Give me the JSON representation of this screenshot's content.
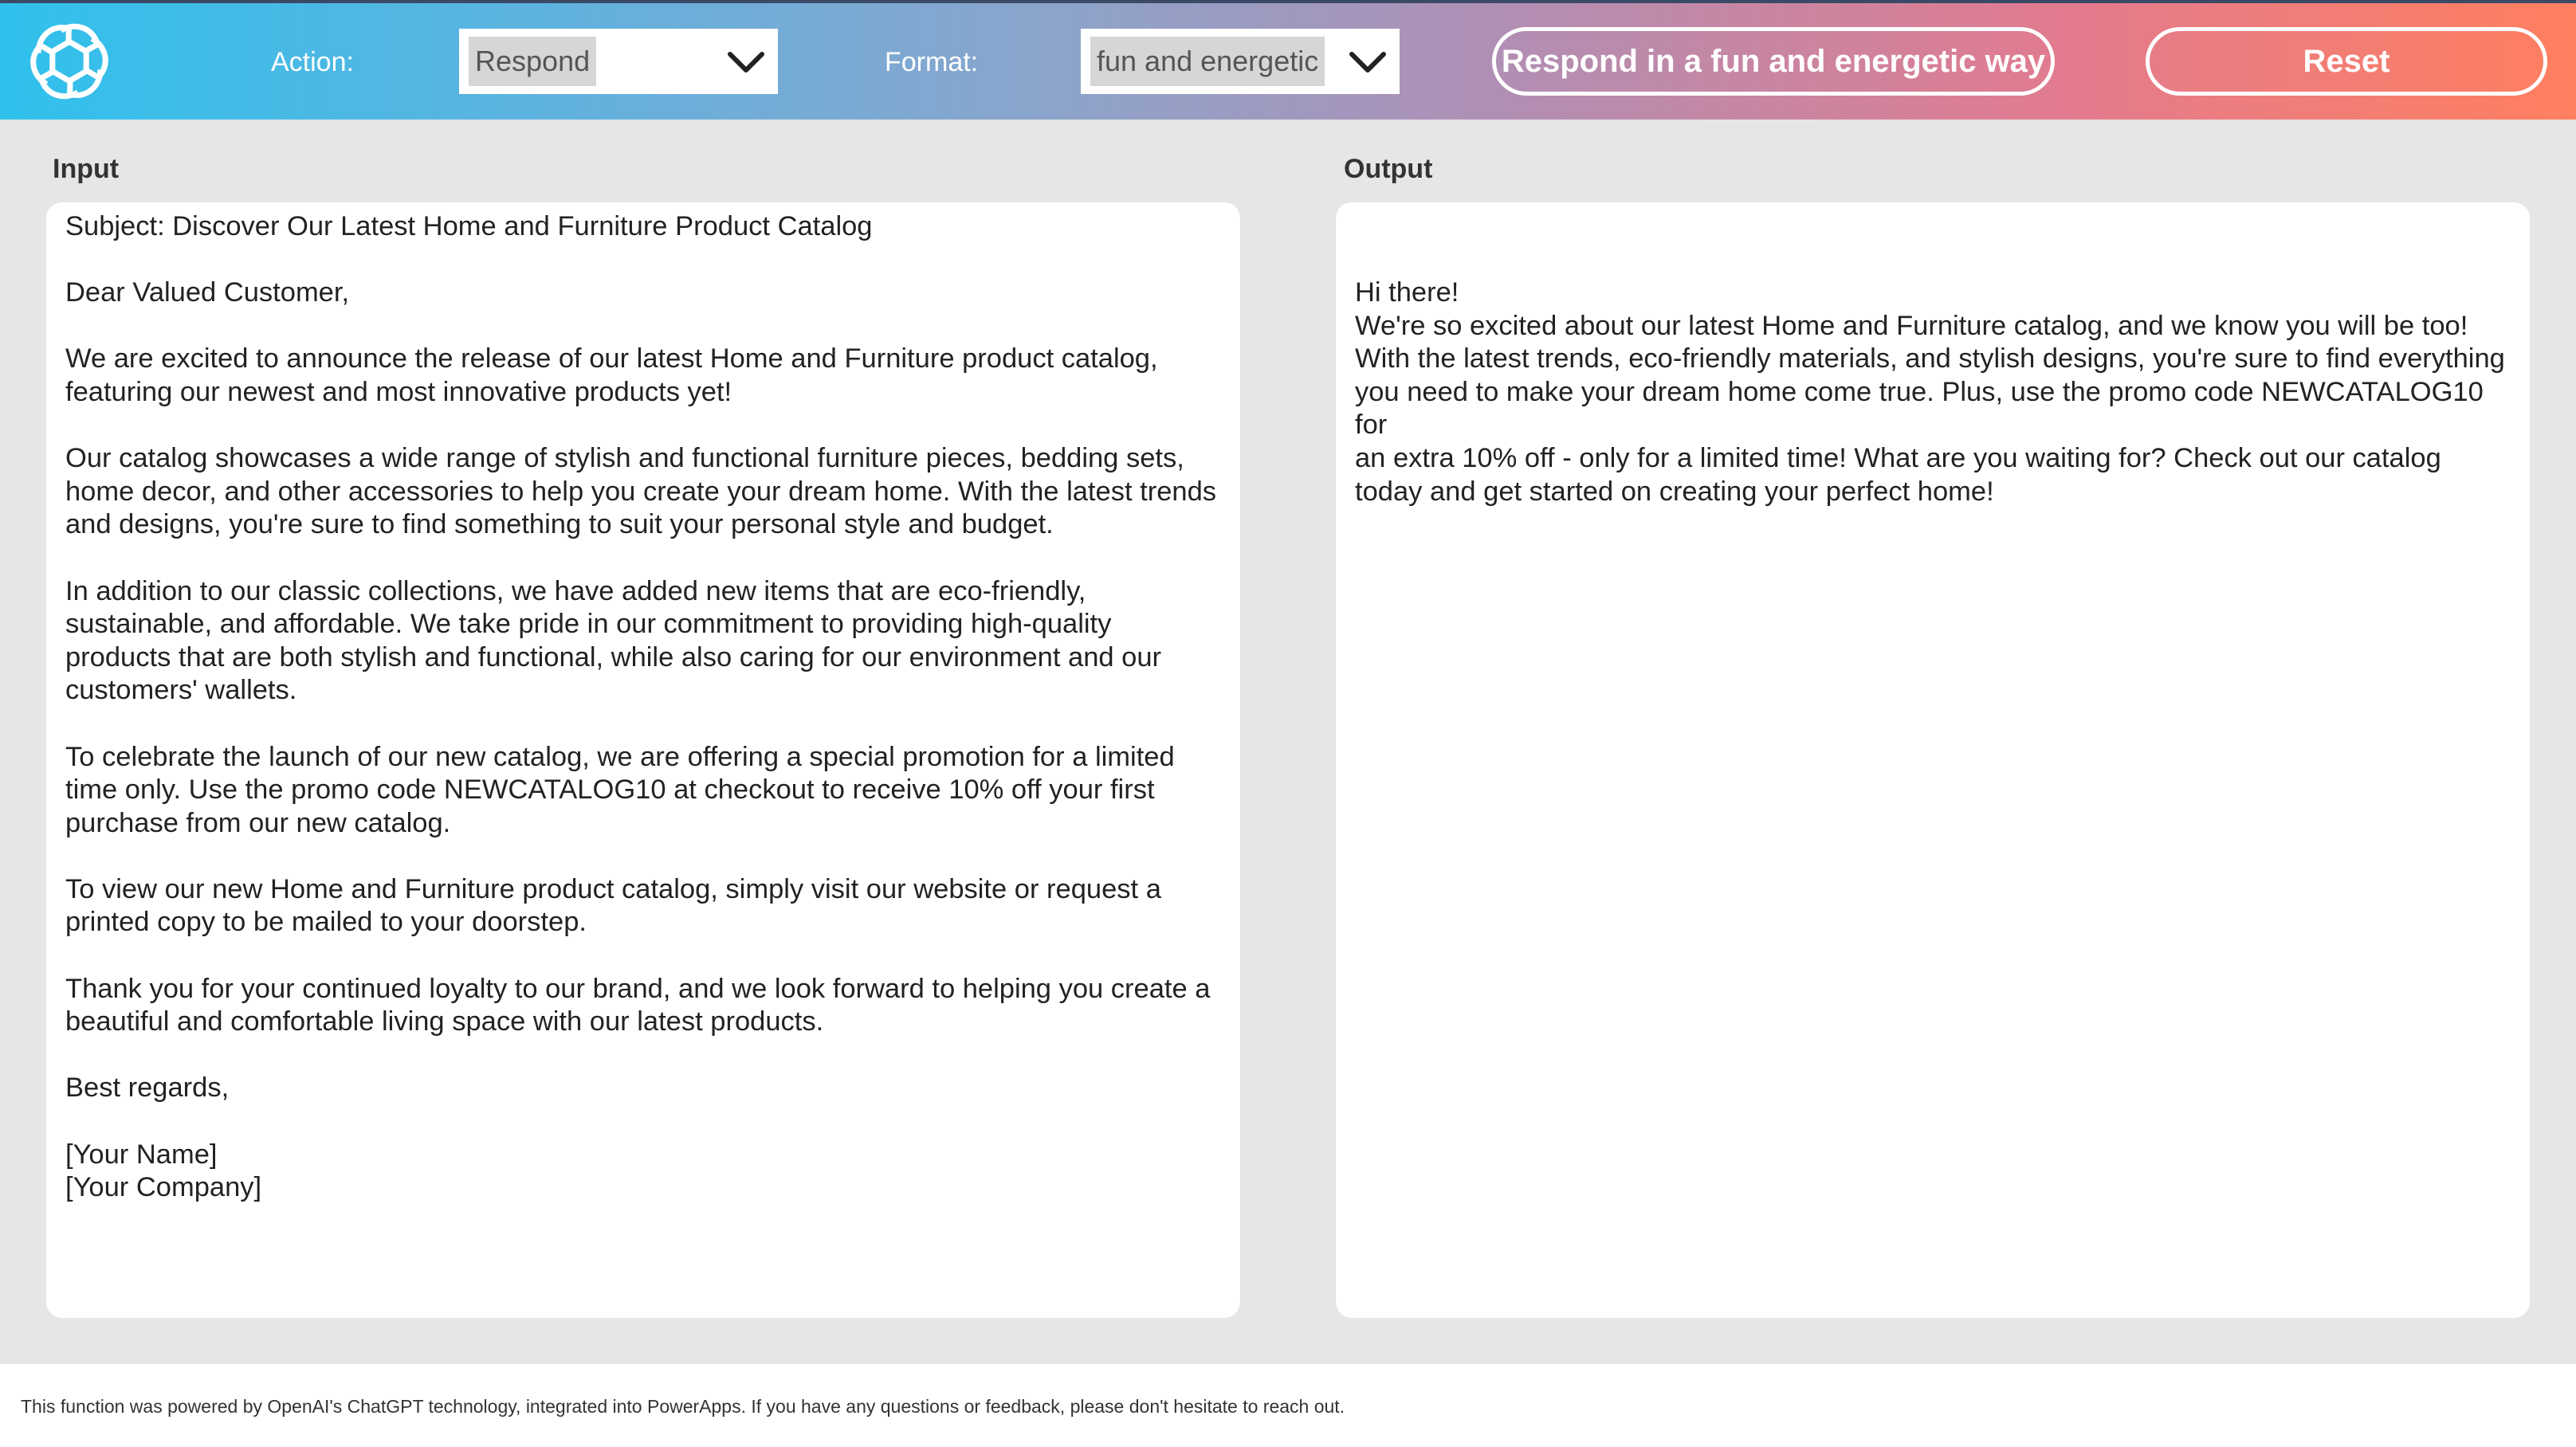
{
  "header": {
    "logo_icon": "openai-logo-icon",
    "action_label": "Action:",
    "action_value": "Respond",
    "format_label": "Format:",
    "format_value": "fun and energetic",
    "respond_button_label": "Respond in a fun and energetic way",
    "reset_button_label": "Reset",
    "gradient_colors": [
      "#2fc1ec",
      "#b08fb4",
      "#ff7f5f"
    ]
  },
  "input": {
    "label": "Input",
    "paragraphs": [
      "Subject: Discover Our Latest Home and Furniture Product Catalog",
      "Dear Valued Customer,",
      "We are excited to announce the release of our latest Home and Furniture product catalog,\nfeaturing our newest and most innovative products yet!",
      "Our catalog showcases a wide range of stylish and functional furniture pieces, bedding sets,\nhome decor, and other accessories to help you create your dream home. With the latest trends\nand designs, you're sure to find something to suit your personal style and budget.",
      "In addition to our classic collections, we have added new items that are eco-friendly,\nsustainable, and affordable. We take pride in our commitment to providing high-quality\nproducts that are both stylish and functional, while also caring for our environment and our\ncustomers' wallets.",
      "To celebrate the launch of our new catalog, we are offering a special promotion for a limited\ntime only. Use the promo code NEWCATALOG10 at checkout to receive 10% off your first\npurchase from our new catalog.",
      "To view our new Home and Furniture product catalog, simply visit our website or request a\nprinted copy to be mailed to your doorstep.",
      "Thank you for your continued loyalty to our brand, and we look forward to helping you create a\nbeautiful and comfortable living space with our latest products.",
      "Best regards,",
      "[Your Name]\n[Your Company]"
    ]
  },
  "output": {
    "label": "Output",
    "lines": [
      "Hi there!",
      "We're so excited about our latest Home and Furniture catalog, and we know you will be too!\nWith the latest trends, eco-friendly materials, and stylish designs, you're sure to find everything\nyou need to make your dream home come true. Plus, use the promo code NEWCATALOG10 for\nan extra 10% off - only for a limited time! What are you waiting for? Check out our catalog\ntoday and get started on creating your perfect home!"
    ]
  },
  "footer": {
    "text": "This function was powered by OpenAI's ChatGPT technology, integrated into PowerApps. If you have any questions or feedback, please don't hesitate to reach out."
  }
}
